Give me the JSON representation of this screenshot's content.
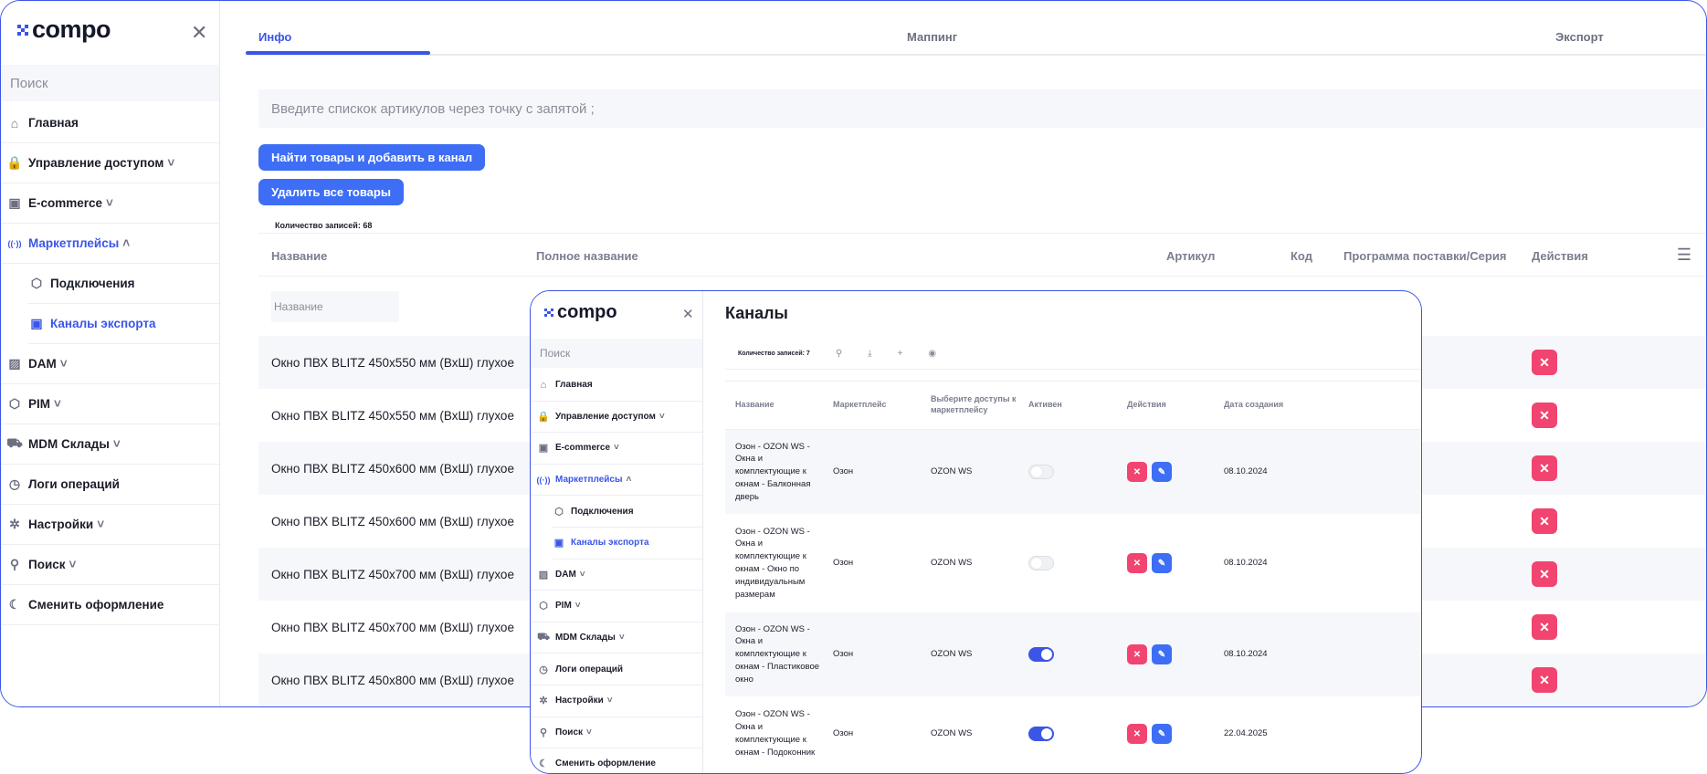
{
  "brand": {
    "name": "compo",
    "accent": "#3b55e6",
    "danger": "#f24470",
    "button_blue": "#3d6ef5"
  },
  "sidebar": {
    "search_placeholder": "Поиск",
    "items": [
      {
        "label": "Главная",
        "icon": "home-icon"
      },
      {
        "label": "Управление доступом",
        "icon": "lock-icon",
        "expandable": true
      },
      {
        "label": "E-commerce",
        "icon": "bag-icon",
        "expandable": true
      },
      {
        "label": "Маркетплейсы",
        "icon": "broadcast-icon",
        "expandable": true,
        "expanded": true,
        "active": true
      },
      {
        "label": "Подключения",
        "icon": "cube-icon",
        "sub": true
      },
      {
        "label": "Каналы экспорта",
        "icon": "bag-icon",
        "sub": true,
        "active": true
      },
      {
        "label": "DAM",
        "icon": "image-icon",
        "expandable": true
      },
      {
        "label": "PIM",
        "icon": "cube-icon",
        "expandable": true
      },
      {
        "label": "MDM Склады",
        "icon": "truck-icon",
        "expandable": true
      },
      {
        "label": "Логи операций",
        "icon": "clock-icon"
      },
      {
        "label": "Настройки",
        "icon": "gear-icon",
        "expandable": true
      },
      {
        "label": "Поиск",
        "icon": "search-icon",
        "expandable": true
      },
      {
        "label": "Сменить оформление",
        "icon": "moon-icon"
      }
    ]
  },
  "back": {
    "tabs": [
      "Инфо",
      "Маппинг",
      "Экспорт"
    ],
    "active_tab": 0,
    "articles_placeholder": "Введите спискок артикулов через точку с запятой ;",
    "find_button": "Найти товары и добавить в канал",
    "delete_all_button": "Удалить все товары",
    "records_count": "Количество записей: 68",
    "columns": [
      "Название",
      "Полное название",
      "Артикул",
      "Код",
      "Программа поставки/Серия",
      "Действия"
    ],
    "filter_placeholder": "Название",
    "rows": [
      "Окно ПВХ BLITZ 450x550 мм (ВхШ) глухое",
      "Окно ПВХ BLITZ 450x550 мм (ВхШ) глухое",
      "Окно ПВХ BLITZ 450x600 мм (ВхШ) глухое",
      "Окно ПВХ BLITZ 450x600 мм (ВхШ) глухое",
      "Окно ПВХ BLITZ 450x700 мм (ВхШ) глухое",
      "Окно ПВХ BLITZ 450x700 мм (ВхШ) глухое",
      "Окно ПВХ BLITZ 450x800 мм (ВхШ) глухое"
    ]
  },
  "front": {
    "title": "Каналы",
    "records_count": "Количество записей: 7",
    "toolbar_icons": [
      "search-icon",
      "download-icon",
      "plus-icon",
      "eye-icon"
    ],
    "columns": [
      "Название",
      "Маркетплейс",
      "Выберите доступы к маркетплейсу",
      "Активен",
      "Действия",
      "Дата создания"
    ],
    "rows": [
      {
        "name": "Озон - OZON WS - Окна и комплектующие к окнам - Балконная дверь",
        "marketplace": "Озон",
        "access": "OZON WS",
        "active": false,
        "date": "08.10.2024"
      },
      {
        "name": "Озон - OZON WS - Окна и комплектующие к окнам - Окно по индивидуальным размерам",
        "marketplace": "Озон",
        "access": "OZON WS",
        "active": false,
        "date": "08.10.2024"
      },
      {
        "name": "Озон - OZON WS - Окна и комплектующие к окнам - Пластиковое окно",
        "marketplace": "Озон",
        "access": "OZON WS",
        "active": true,
        "date": "08.10.2024"
      },
      {
        "name": "Озон - OZON WS - Окна и комплектующие к окнам - Подоконник",
        "marketplace": "Озон",
        "access": "OZON WS",
        "active": true,
        "date": "22.04.2025"
      }
    ]
  }
}
